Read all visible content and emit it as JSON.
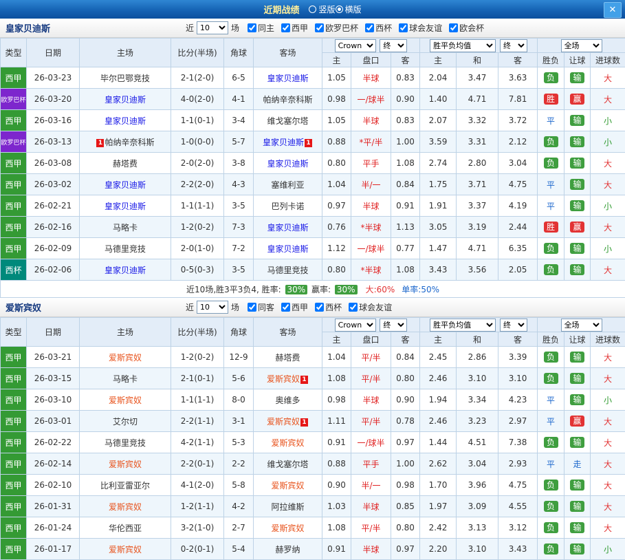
{
  "titlebar": {
    "title": "近期战绩",
    "radios": [
      {
        "label": "竖版",
        "checked": false
      },
      {
        "label": "横版",
        "checked": true
      }
    ],
    "close_label": "✕"
  },
  "labels": {
    "near": "近",
    "games": "场"
  },
  "table_header": {
    "type": "类型",
    "date": "日期",
    "home": "主场",
    "score": "比分(半场)",
    "corner": "角球",
    "away": "客场",
    "company": "Crown",
    "final": "终",
    "europe_avg": "胜平负均值",
    "full_match": "全场",
    "odds_home": "主",
    "odds_line": "盘口",
    "odds_away": "客",
    "ep_home": "主",
    "ep_draw": "和",
    "ep_away": "客",
    "result": "胜负",
    "spread": "让球",
    "goals": "进球数"
  },
  "colors": {
    "win": "#e23333",
    "loss": "#3f9e3f",
    "draw": "#1a66cc",
    "over": "#e23333",
    "under": "#2f9a2f",
    "line": "#e02222"
  },
  "league_colors": {
    "西甲": "#349a34",
    "欧罗巴杯": "#7d26cd",
    "西杯": "#00897b"
  },
  "sections": [
    {
      "team": "皇家贝迪斯",
      "self_color": "#1515e6",
      "near_value": "10",
      "filters": [
        {
          "label": "同主",
          "checked": true
        },
        {
          "label": "西甲",
          "checked": true
        },
        {
          "label": "欧罗巴杯",
          "checked": true
        },
        {
          "label": "西杯",
          "checked": true
        },
        {
          "label": "球会友谊",
          "checked": true
        },
        {
          "label": "欧会杯",
          "checked": true
        }
      ],
      "rows": [
        {
          "league": "西甲",
          "date": "26-03-23",
          "home": "毕尔巴鄂竞技",
          "home_self": false,
          "score": "2-1(2-0)",
          "corner": "6-5",
          "away": "皇家贝迪斯",
          "away_self": true,
          "odds": [
            "1.05",
            "半球",
            "0.83"
          ],
          "europe": [
            "2.04",
            "3.47",
            "3.63"
          ],
          "result": "负",
          "spread": "输",
          "goals": "大"
        },
        {
          "league": "欧罗巴杯",
          "date": "26-03-20",
          "home": "皇家贝迪斯",
          "home_self": true,
          "score": "4-0(2-0)",
          "corner": "4-1",
          "away": "帕纳辛奈科斯",
          "away_self": false,
          "odds": [
            "0.98",
            "一/球半",
            "0.90"
          ],
          "europe": [
            "1.40",
            "4.71",
            "7.81"
          ],
          "result": "胜",
          "spread": "赢",
          "goals": "大"
        },
        {
          "league": "西甲",
          "date": "26-03-16",
          "home": "皇家贝迪斯",
          "home_self": true,
          "score": "1-1(0-1)",
          "corner": "3-4",
          "away": "维戈塞尔塔",
          "away_self": false,
          "odds": [
            "1.05",
            "半球",
            "0.83"
          ],
          "europe": [
            "2.07",
            "3.32",
            "3.72"
          ],
          "result": "平",
          "spread": "输",
          "goals": "小"
        },
        {
          "league": "欧罗巴杯",
          "date": "26-03-13",
          "home": "帕纳辛奈科斯",
          "home_self": false,
          "home_card": "before",
          "score": "1-0(0-0)",
          "corner": "5-7",
          "away": "皇家贝迪斯",
          "away_self": true,
          "away_card": "after",
          "odds": [
            "0.88",
            "*平/半",
            "1.00"
          ],
          "europe": [
            "3.59",
            "3.31",
            "2.12"
          ],
          "result": "负",
          "spread": "输",
          "goals": "小"
        },
        {
          "league": "西甲",
          "date": "26-03-08",
          "home": "赫塔费",
          "home_self": false,
          "score": "2-0(2-0)",
          "corner": "3-8",
          "away": "皇家贝迪斯",
          "away_self": true,
          "odds": [
            "0.80",
            "平手",
            "1.08"
          ],
          "europe": [
            "2.74",
            "2.80",
            "3.04"
          ],
          "result": "负",
          "spread": "输",
          "goals": "大"
        },
        {
          "league": "西甲",
          "date": "26-03-02",
          "home": "皇家贝迪斯",
          "home_self": true,
          "score": "2-2(2-0)",
          "corner": "4-3",
          "away": "塞维利亚",
          "away_self": false,
          "odds": [
            "1.04",
            "半/一",
            "0.84"
          ],
          "europe": [
            "1.75",
            "3.71",
            "4.75"
          ],
          "result": "平",
          "spread": "输",
          "goals": "大"
        },
        {
          "league": "西甲",
          "date": "26-02-21",
          "home": "皇家贝迪斯",
          "home_self": true,
          "score": "1-1(1-1)",
          "corner": "3-5",
          "away": "巴列卡诺",
          "away_self": false,
          "odds": [
            "0.97",
            "半球",
            "0.91"
          ],
          "europe": [
            "1.91",
            "3.37",
            "4.19"
          ],
          "result": "平",
          "spread": "输",
          "goals": "小"
        },
        {
          "league": "西甲",
          "date": "26-02-16",
          "home": "马略卡",
          "home_self": false,
          "score": "1-2(0-2)",
          "corner": "7-3",
          "away": "皇家贝迪斯",
          "away_self": true,
          "odds": [
            "0.76",
            "*半球",
            "1.13"
          ],
          "europe": [
            "3.05",
            "3.19",
            "2.44"
          ],
          "result": "胜",
          "spread": "赢",
          "goals": "大"
        },
        {
          "league": "西甲",
          "date": "26-02-09",
          "home": "马德里竞技",
          "home_self": false,
          "score": "2-0(1-0)",
          "corner": "7-2",
          "away": "皇家贝迪斯",
          "away_self": true,
          "odds": [
            "1.12",
            "一/球半",
            "0.77"
          ],
          "europe": [
            "1.47",
            "4.71",
            "6.35"
          ],
          "result": "负",
          "spread": "输",
          "goals": "小"
        },
        {
          "league": "西杯",
          "date": "26-02-06",
          "home": "皇家贝迪斯",
          "home_self": true,
          "score": "0-5(0-3)",
          "corner": "3-5",
          "away": "马德里竞技",
          "away_self": false,
          "odds": [
            "0.80",
            "*半球",
            "1.08"
          ],
          "europe": [
            "3.43",
            "3.56",
            "2.05"
          ],
          "result": "负",
          "spread": "输",
          "goals": "大"
        }
      ],
      "summary": {
        "text": "近10场,胜3平3负4,",
        "win_rate_label": "胜率:",
        "win_rate": "30%",
        "cover_rate_label": "赢率:",
        "cover_rate": "30%",
        "over_rate": "大:60%",
        "single_rate": "单率:50%"
      }
    },
    {
      "team": "爱斯宾奴",
      "self_color": "#e8541e",
      "near_value": "10",
      "filters": [
        {
          "label": "同客",
          "checked": true
        },
        {
          "label": "西甲",
          "checked": true
        },
        {
          "label": "西杯",
          "checked": true
        },
        {
          "label": "球会友谊",
          "checked": true
        }
      ],
      "rows": [
        {
          "league": "西甲",
          "date": "26-03-21",
          "home": "爱斯宾奴",
          "home_self": true,
          "score": "1-2(0-2)",
          "corner": "12-9",
          "away": "赫塔费",
          "away_self": false,
          "odds": [
            "1.04",
            "平/半",
            "0.84"
          ],
          "europe": [
            "2.45",
            "2.86",
            "3.39"
          ],
          "result": "负",
          "spread": "输",
          "goals": "大"
        },
        {
          "league": "西甲",
          "date": "26-03-15",
          "home": "马略卡",
          "home_self": false,
          "score": "2-1(0-1)",
          "corner": "5-6",
          "away": "爱斯宾奴",
          "away_self": true,
          "away_card": "after",
          "odds": [
            "1.08",
            "平/半",
            "0.80"
          ],
          "europe": [
            "2.46",
            "3.10",
            "3.10"
          ],
          "result": "负",
          "spread": "输",
          "goals": "大"
        },
        {
          "league": "西甲",
          "date": "26-03-10",
          "home": "爱斯宾奴",
          "home_self": true,
          "score": "1-1(1-1)",
          "corner": "8-0",
          "away": "奥维多",
          "away_self": false,
          "odds": [
            "0.98",
            "半球",
            "0.90"
          ],
          "europe": [
            "1.94",
            "3.34",
            "4.23"
          ],
          "result": "平",
          "spread": "输",
          "goals": "小"
        },
        {
          "league": "西甲",
          "date": "26-03-01",
          "home": "艾尔切",
          "home_self": false,
          "score": "2-2(1-1)",
          "corner": "3-1",
          "away": "爱斯宾奴",
          "away_self": true,
          "away_card": "after",
          "odds": [
            "1.11",
            "平/半",
            "0.78"
          ],
          "europe": [
            "2.46",
            "3.23",
            "2.97"
          ],
          "result": "平",
          "spread": "赢",
          "goals": "大"
        },
        {
          "league": "西甲",
          "date": "26-02-22",
          "home": "马德里竞技",
          "home_self": false,
          "score": "4-2(1-1)",
          "corner": "5-3",
          "away": "爱斯宾奴",
          "away_self": true,
          "odds": [
            "0.91",
            "一/球半",
            "0.97"
          ],
          "europe": [
            "1.44",
            "4.51",
            "7.38"
          ],
          "result": "负",
          "spread": "输",
          "goals": "大"
        },
        {
          "league": "西甲",
          "date": "26-02-14",
          "home": "爱斯宾奴",
          "home_self": true,
          "score": "2-2(0-1)",
          "corner": "2-2",
          "away": "维戈塞尔塔",
          "away_self": false,
          "odds": [
            "0.88",
            "平手",
            "1.00"
          ],
          "europe": [
            "2.62",
            "3.04",
            "2.93"
          ],
          "result": "平",
          "spread": "走",
          "goals": "大"
        },
        {
          "league": "西甲",
          "date": "26-02-10",
          "home": "比利亚雷亚尔",
          "home_self": false,
          "score": "4-1(2-0)",
          "corner": "5-8",
          "away": "爱斯宾奴",
          "away_self": true,
          "odds": [
            "0.90",
            "半/一",
            "0.98"
          ],
          "europe": [
            "1.70",
            "3.96",
            "4.75"
          ],
          "result": "负",
          "spread": "输",
          "goals": "大"
        },
        {
          "league": "西甲",
          "date": "26-01-31",
          "home": "爱斯宾奴",
          "home_self": true,
          "score": "1-2(1-1)",
          "corner": "4-2",
          "away": "阿拉维斯",
          "away_self": false,
          "odds": [
            "1.03",
            "半球",
            "0.85"
          ],
          "europe": [
            "1.97",
            "3.09",
            "4.55"
          ],
          "result": "负",
          "spread": "输",
          "goals": "大"
        },
        {
          "league": "西甲",
          "date": "26-01-24",
          "home": "华伦西亚",
          "home_self": false,
          "score": "3-2(1-0)",
          "corner": "2-7",
          "away": "爱斯宾奴",
          "away_self": true,
          "odds": [
            "1.08",
            "平/半",
            "0.80"
          ],
          "europe": [
            "2.42",
            "3.13",
            "3.12"
          ],
          "result": "负",
          "spread": "输",
          "goals": "大"
        },
        {
          "league": "西甲",
          "date": "26-01-17",
          "home": "爱斯宾奴",
          "home_self": true,
          "score": "0-2(0-1)",
          "corner": "5-4",
          "away": "赫罗纳",
          "away_self": false,
          "odds": [
            "0.91",
            "半球",
            "0.97"
          ],
          "europe": [
            "2.20",
            "3.10",
            "3.43"
          ],
          "result": "负",
          "spread": "输",
          "goals": "小"
        }
      ]
    }
  ]
}
